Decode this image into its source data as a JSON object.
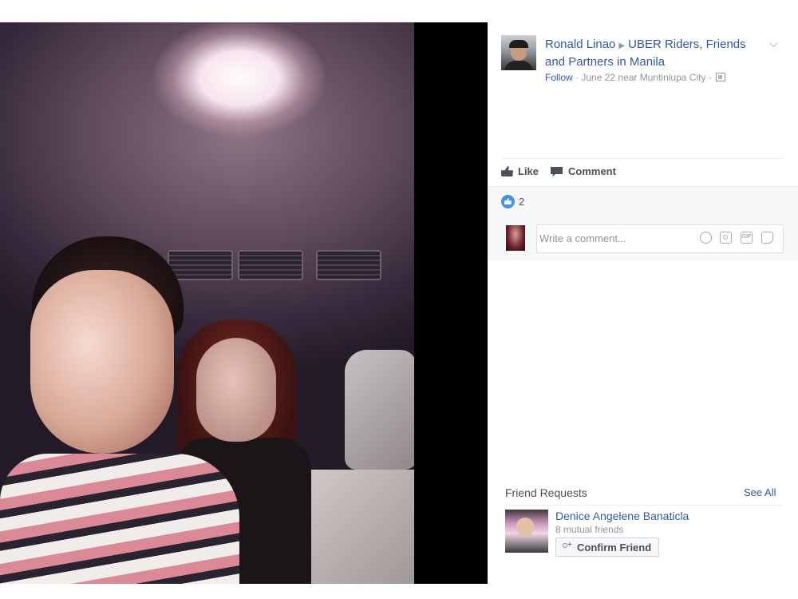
{
  "post": {
    "author": "Ronald Linao",
    "group": "UBER Riders, Friends and Partners in Manila",
    "follow_label": "Follow",
    "meta": " · June 22 near Muntinlupa City · ",
    "audience_icon": "group-audience-icon",
    "options_icon": "chevron-down-icon"
  },
  "actions": {
    "like_label": "Like",
    "comment_label": "Comment"
  },
  "reactions": {
    "like_count": "2"
  },
  "comment_input": {
    "placeholder": "Write a comment...",
    "icons": [
      "emoji-icon",
      "camera-icon",
      "gif-icon",
      "sticker-icon"
    ],
    "gif_label": "GIF"
  },
  "friend_requests": {
    "header": "Friend Requests",
    "see_all": "See All",
    "items": [
      {
        "name": "Denice Angelene Banaticla",
        "mutual": "8 mutual friends",
        "confirm_label": "Confirm Friend"
      }
    ]
  },
  "colors": {
    "link_blue": "#365899",
    "meta_gray": "#90949c",
    "like_blue": "#4a90e2",
    "photo_bg": "#000000"
  }
}
